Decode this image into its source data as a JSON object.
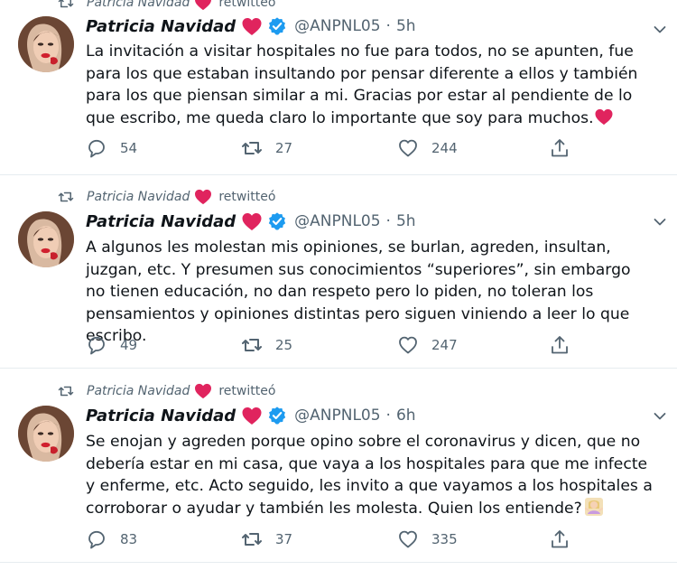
{
  "tweets": [
    {
      "retweeted_by": "Patricia Navidad",
      "retweet_suffix": "retwitteó",
      "author_name": "Patricia Navidad",
      "handle": "@ANPNL05",
      "separator": "·",
      "time": "5h",
      "text": "La invitación a visitar hospitales no fue para todos, no se apunten, fue para los que estaban insultando por pensar diferente a ellos y también para los que piensan similar a mi. Gracias por estar al pendiente de lo que escribo, me queda claro lo importante que soy para muchos.",
      "replies": "54",
      "retweets": "27",
      "likes": "244"
    },
    {
      "retweeted_by": "Patricia Navidad",
      "retweet_suffix": "retwitteó",
      "author_name": "Patricia Navidad",
      "handle": "@ANPNL05",
      "separator": "·",
      "time": "5h",
      "text": "A algunos les molestan mis opiniones, se burlan, agreden, insultan, juzgan, etc. Y presumen sus conocimientos “superiores”, sin embargo no tienen educación, no dan respeto pero lo piden, no toleran los pensamientos y opiniones distintas pero siguen viniendo a leer lo que escribo.",
      "replies": "49",
      "retweets": "25",
      "likes": "247"
    },
    {
      "retweeted_by": "Patricia Navidad",
      "retweet_suffix": "retwitteó",
      "author_name": "Patricia Navidad",
      "handle": "@ANPNL05",
      "separator": "·",
      "time": "6h",
      "text": "Se enojan y agreden porque opino sobre el coronavirus y dicen, que no debería estar en mi casa, que vaya a los hospitales para que me infecte y enferme, etc. Acto seguido, les invito a que vayamos a los hospitales a corroborar o ayudar y también les molesta. Quien los entiende?",
      "replies": "83",
      "retweets": "37",
      "likes": "335"
    }
  ],
  "colors": {
    "heart": "#e0245e",
    "verified": "#1d9bf0",
    "muted": "#536471",
    "text": "#0f1419",
    "divider": "#e6ecf0"
  },
  "icons": [
    "retweet-icon",
    "heart-icon",
    "verified-badge-icon",
    "chevron-down-icon",
    "reply-icon",
    "like-icon",
    "share-icon",
    "shrug-emoji-icon"
  ]
}
